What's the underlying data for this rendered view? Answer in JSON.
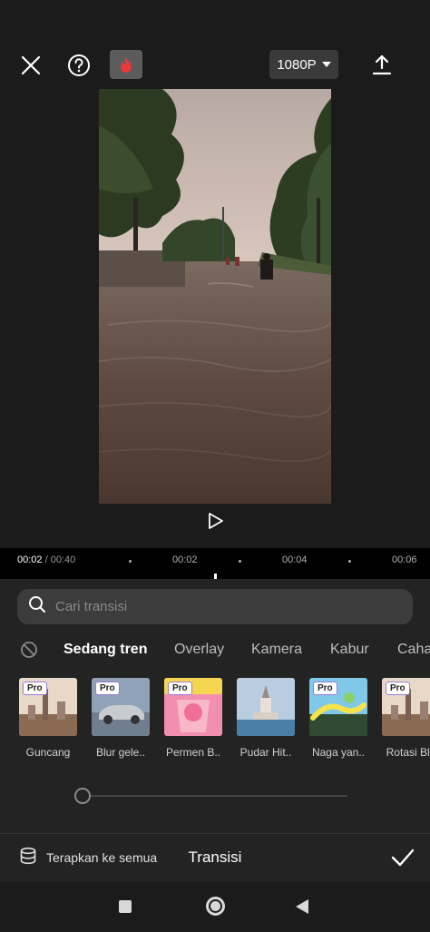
{
  "topbar": {
    "resolution_label": "1080P",
    "icons": [
      "close-icon",
      "help-icon",
      "flame-icon",
      "chevron-down-icon",
      "export-icon"
    ]
  },
  "timeline": {
    "current_time": "00:02",
    "separator": " / ",
    "total_time": "00:40",
    "markers": [
      "00:02",
      "00:04",
      "00:06"
    ]
  },
  "search": {
    "placeholder": "Cari transisi"
  },
  "tabs": [
    {
      "label": "Sedang tren",
      "active": true
    },
    {
      "label": "Overlay",
      "active": false
    },
    {
      "label": "Kamera",
      "active": false
    },
    {
      "label": "Kabur",
      "active": false
    },
    {
      "label": "Caha",
      "active": false
    }
  ],
  "transitions": [
    {
      "label": "Guncang",
      "pro": "Pro"
    },
    {
      "label": "Blur gele..",
      "pro": "Pro"
    },
    {
      "label": "Permen B..",
      "pro": "Pro"
    },
    {
      "label": "Pudar Hit..",
      "pro": ""
    },
    {
      "label": "Naga yan..",
      "pro": "Pro"
    },
    {
      "label": "Rotasi Blu",
      "pro": "Pro"
    }
  ],
  "duration_slider": {
    "value_fraction": 0.0
  },
  "footer": {
    "apply_all_label": "Terapkan ke semua",
    "title": "Transisi"
  },
  "colors": {
    "background": "#1b1b1b",
    "panel": "#232323",
    "search_bg": "#3c3c3c",
    "flame": "#e83b3b"
  }
}
